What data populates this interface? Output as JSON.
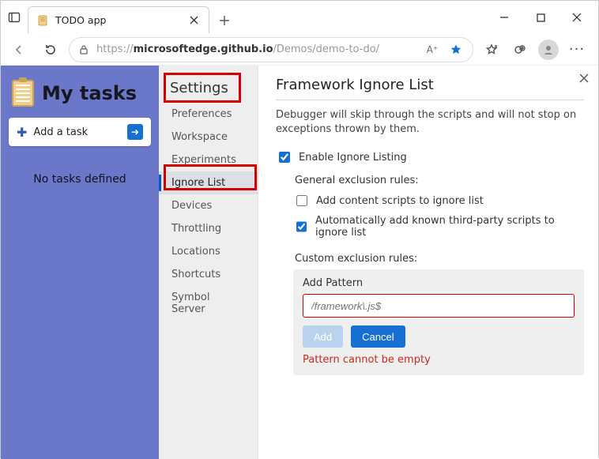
{
  "window": {
    "tab_title": "TODO app"
  },
  "toolbar": {
    "url_host": "microsoftedge.github.io",
    "url_path": "/Demos/demo-to-do/",
    "aa_label": "A⁺"
  },
  "app": {
    "title": "My tasks",
    "add_task_label": "Add a task",
    "empty_msg": "No tasks defined"
  },
  "sidebar": {
    "heading": "Settings",
    "items": [
      "Preferences",
      "Workspace",
      "Experiments",
      "Ignore List",
      "Devices",
      "Throttling",
      "Locations",
      "Shortcuts",
      "Symbol Server"
    ],
    "active_index": 3
  },
  "panel": {
    "title": "Framework Ignore List",
    "desc": "Debugger will skip through the scripts and will not stop on exceptions thrown by them.",
    "enable_label": "Enable Ignore Listing",
    "enable_checked": true,
    "general_heading": "General exclusion rules:",
    "general_rules": [
      {
        "label": "Add content scripts to ignore list",
        "checked": false
      },
      {
        "label": "Automatically add known third-party scripts to ignore list",
        "checked": true
      }
    ],
    "custom_heading": "Custom exclusion rules:",
    "add_pattern_label": "Add Pattern",
    "pattern_placeholder": "/framework\\.js$",
    "add_btn": "Add",
    "cancel_btn": "Cancel",
    "error_msg": "Pattern cannot be empty"
  }
}
